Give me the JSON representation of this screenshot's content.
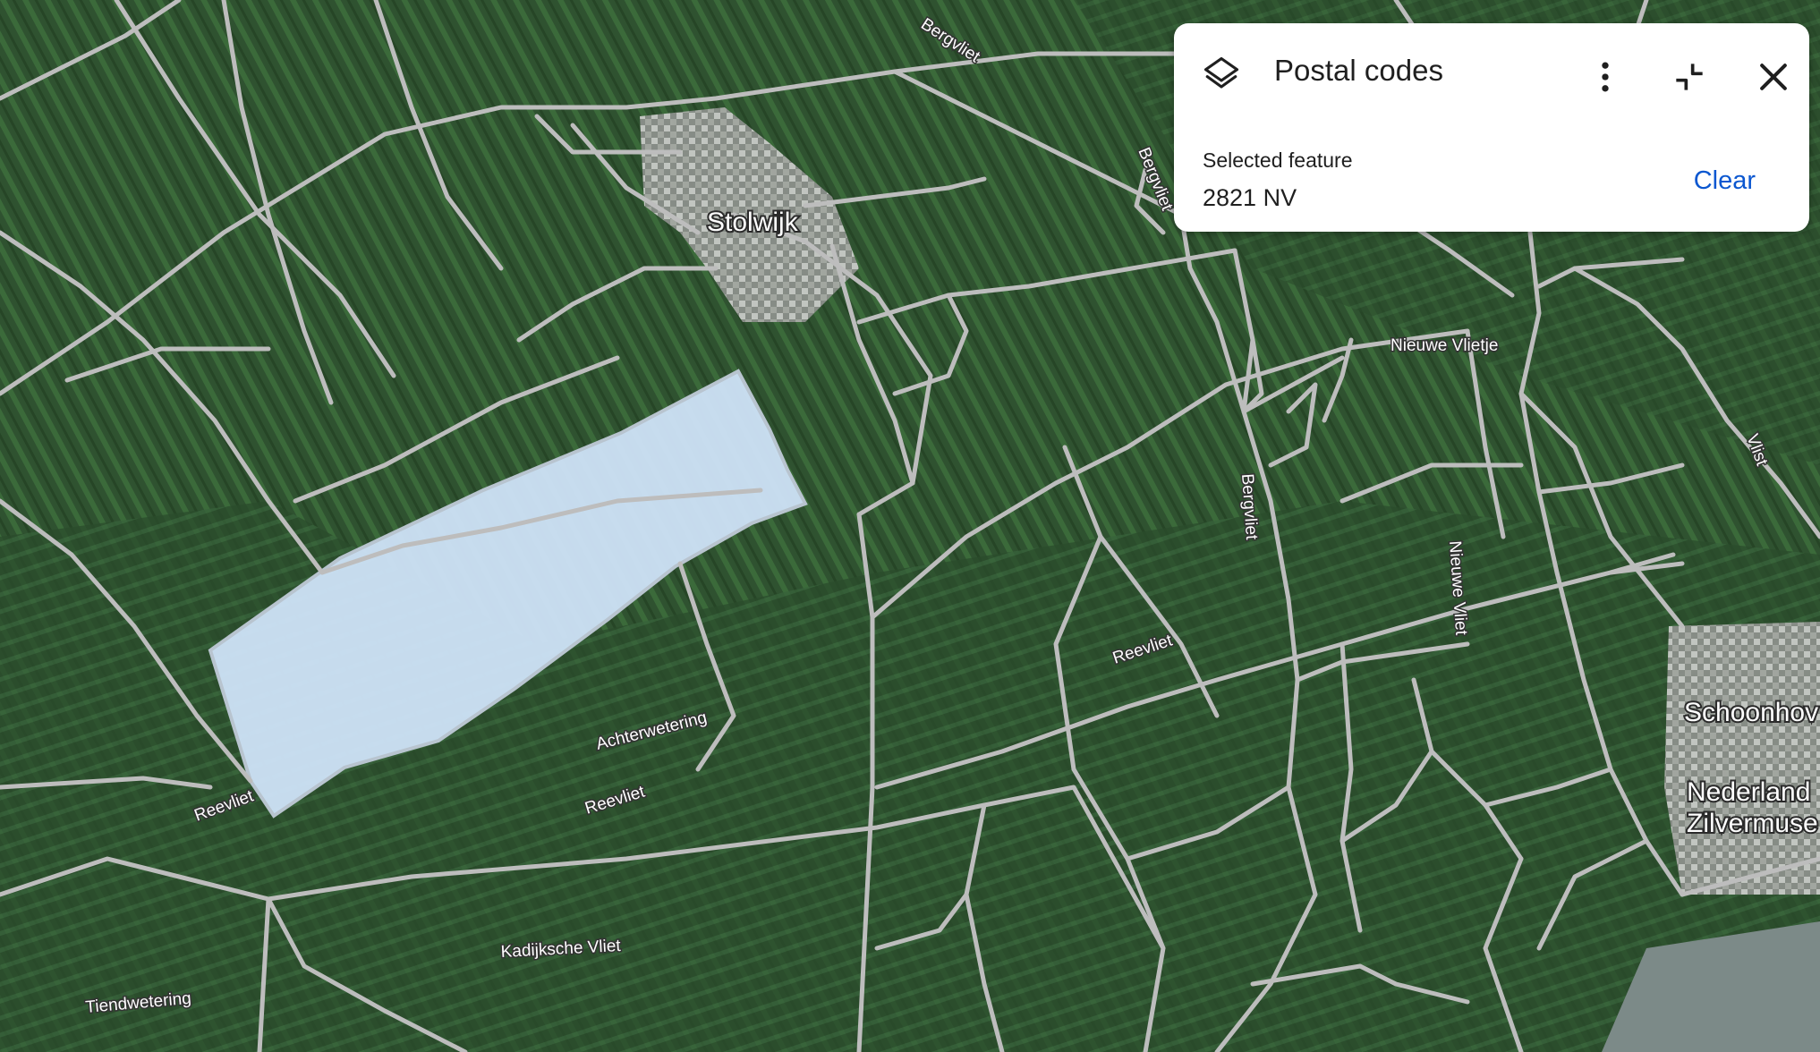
{
  "panel": {
    "title": "Postal codes",
    "selected_label": "Selected feature",
    "selected_value": "2821 NV",
    "clear_label": "Clear",
    "icons": {
      "layers": "layers-icon",
      "more": "more-vert-icon",
      "collapse": "collapse-icon",
      "close": "close-icon"
    }
  },
  "map": {
    "type": "satellite",
    "selected_area_color": "#cfe3f8",
    "boundary_color": "#bdbdbd",
    "town_labels": [
      "Stolwijk",
      "Schoonhov",
      "Nederland",
      "Zilvermuse"
    ],
    "road_labels": [
      "Bergvliet",
      "Bergvliet",
      "Bergvliet",
      "Nieuwe Vlietje",
      "Nieuwe Vliet",
      "Vlist",
      "Reevliet",
      "Reevliet",
      "Reevliet",
      "Achterwetering",
      "Kadijksche Vliet",
      "Tiendwetering"
    ]
  }
}
